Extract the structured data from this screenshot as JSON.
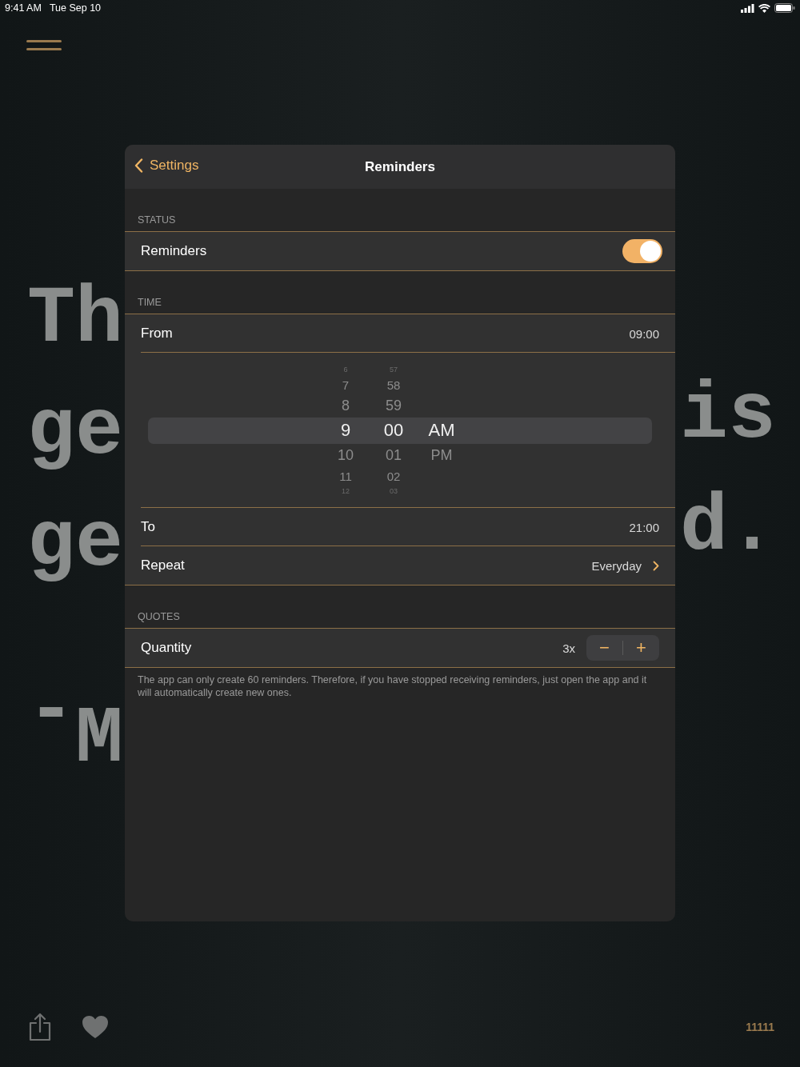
{
  "status_bar": {
    "time": "9:41 AM",
    "date": "Tue Sep 10"
  },
  "background_quote": {
    "left_fragments": [
      "Th",
      "ge",
      "ge",
      "-",
      "M"
    ],
    "right_fragments": [
      "is",
      "d."
    ]
  },
  "modal": {
    "back_label": "Settings",
    "title": "Reminders",
    "sections": [
      {
        "header": "STATUS",
        "rows": [
          {
            "kind": "toggle",
            "label": "Reminders",
            "on": true
          }
        ]
      },
      {
        "header": "TIME",
        "rows": [
          {
            "kind": "value",
            "label": "From",
            "value": "09:00"
          },
          {
            "kind": "picker",
            "columns": [
              {
                "items": [
                  {
                    "text": "6",
                    "selected": false
                  },
                  {
                    "text": "7",
                    "selected": false
                  },
                  {
                    "text": "8",
                    "selected": false
                  },
                  {
                    "text": "9",
                    "selected": true
                  },
                  {
                    "text": "10",
                    "selected": false
                  },
                  {
                    "text": "11",
                    "selected": false
                  },
                  {
                    "text": "12",
                    "selected": false
                  }
                ]
              },
              {
                "items": [
                  {
                    "text": "57",
                    "selected": false
                  },
                  {
                    "text": "58",
                    "selected": false
                  },
                  {
                    "text": "59",
                    "selected": false
                  },
                  {
                    "text": "00",
                    "selected": true
                  },
                  {
                    "text": "01",
                    "selected": false
                  },
                  {
                    "text": "02",
                    "selected": false
                  },
                  {
                    "text": "03",
                    "selected": false
                  }
                ]
              },
              {
                "items": [
                  {
                    "text": "AM",
                    "selected": true
                  },
                  {
                    "text": "PM",
                    "selected": false
                  }
                ]
              }
            ]
          },
          {
            "kind": "value",
            "label": "To",
            "value": "21:00"
          },
          {
            "kind": "link",
            "label": "Repeat",
            "value": "Everyday"
          }
        ]
      },
      {
        "header": "QUOTES",
        "rows": [
          {
            "kind": "stepper",
            "label": "Quantity",
            "value": "3x",
            "minus": "−",
            "plus": "+"
          }
        ],
        "footer": "The app can only create 60 reminders. Therefore, if you have stopped receiving reminders, just open the app and it will automatically create new ones."
      }
    ]
  },
  "bottom_bar": {
    "counter": "11111"
  }
}
